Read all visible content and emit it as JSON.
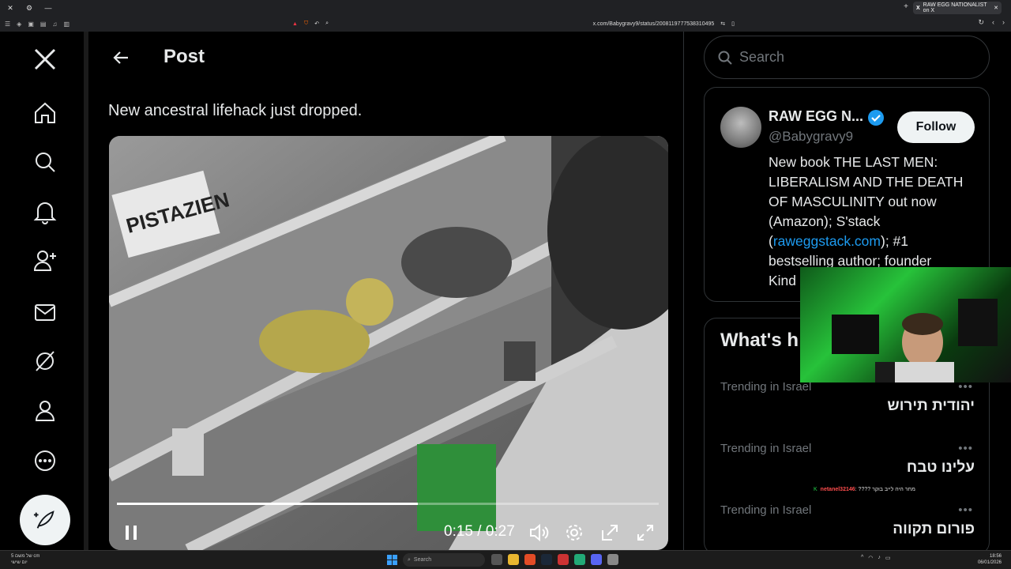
{
  "browser": {
    "tab_title": "RAW EGG NATIONALIST on X",
    "url": "x.com/Babygravy9/status/2008119777538310495"
  },
  "nav": {
    "items": [
      "x-logo",
      "home-icon",
      "search-icon",
      "bell-icon",
      "add-user-icon",
      "mail-icon",
      "grok-icon",
      "profile-icon",
      "more-icon"
    ],
    "compose_icon": "feather-icon"
  },
  "post": {
    "header_title": "Post",
    "text": "New ancestral lifehack just dropped.",
    "video": {
      "time_current": "0:15",
      "time_total": "0:27",
      "time_display": "0:15 / 0:27",
      "progress": 0.555
    }
  },
  "sidebar": {
    "search_placeholder": "Search",
    "profile": {
      "name": "RAW EGG N...",
      "handle": "@Babygravy9",
      "follow_label": "Follow",
      "bio_line1": "New book THE LAST MEN:",
      "bio_line2": "LIBERALISM AND THE DEATH",
      "bio_line3": "OF MASCULINITY out now",
      "bio_line4": "(Amazon); S'stack",
      "bio_link_open": "(",
      "bio_link": "raweggstack.com",
      "bio_link_close": "); #1",
      "bio_line6": "bestselling author; founder",
      "bio_line7": "Kind"
    },
    "trends_title": "What's h",
    "trends": [
      {
        "meta": "Trending in Israel",
        "name": "יהודית תירוש"
      },
      {
        "meta": "Trending in Israel",
        "name": "עלינו טבח"
      },
      {
        "meta": "Trending in Israel",
        "name": "פורום תקווה"
      }
    ]
  },
  "overlay": {
    "chat_user": "netanel32146",
    "chat_text": ": ???? מחר היה לייב בוקר"
  },
  "taskbar": {
    "weather_line1": "של משם 5 cm",
    "weather_line2": "יום שישי",
    "search_label": "Search",
    "clock_time": "18:56",
    "clock_date": "06/01/2026"
  }
}
